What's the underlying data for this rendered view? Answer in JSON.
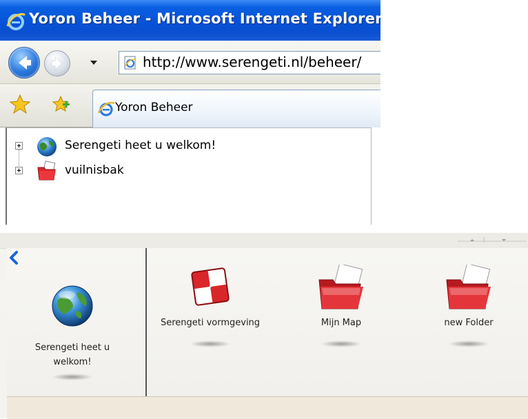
{
  "window": {
    "title": "Yoron Beheer - Microsoft Internet Explorer",
    "address_url": "http://www.serengeti.nl/beheer/",
    "tab_label": "Yoron Beheer"
  },
  "tree": {
    "items": [
      {
        "label": "Serengeti heet u welkom!",
        "icon": "globe-icon"
      },
      {
        "label": "vuilnisbak",
        "icon": "red-folder-icon"
      }
    ]
  },
  "panel": {
    "current": {
      "label": "Serengeti heet u welkom!",
      "icon": "globe-icon"
    },
    "items": [
      {
        "label": "Serengeti vormgeving",
        "icon": "checkered-theme-icon"
      },
      {
        "label": "Mijn Map",
        "icon": "red-folder-icon"
      },
      {
        "label": "new Folder",
        "icon": "red-folder-icon"
      }
    ]
  },
  "colors": {
    "titlebar": "#0553d8",
    "folder_red": "#d9262a",
    "back_arrow": "#1a66d8"
  }
}
